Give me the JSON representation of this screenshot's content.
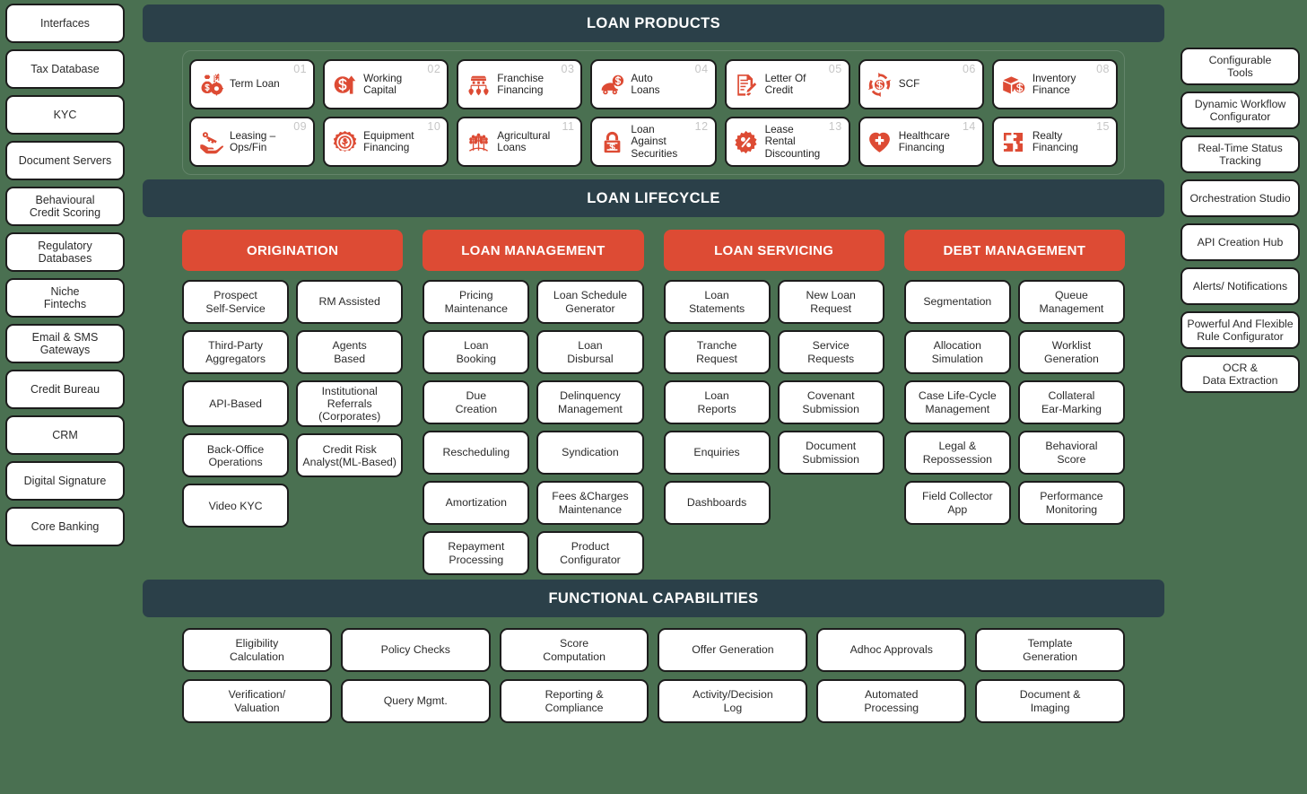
{
  "colors": {
    "background": "#4a7051",
    "band": "#2b4049",
    "accent": "#dd4b34",
    "card_bg": "#ffffff",
    "card_border": "#1c1c1c",
    "number": "#c6c6c6"
  },
  "left_sidebar": {
    "items": [
      {
        "label": "Interfaces"
      },
      {
        "label": "Tax Database"
      },
      {
        "label": "KYC"
      },
      {
        "label": "Document Servers"
      },
      {
        "label": "Behavioural\nCredit Scoring"
      },
      {
        "label": "Regulatory\nDatabases"
      },
      {
        "label": "Niche\nFintechs"
      },
      {
        "label": "Email & SMS\nGateways"
      },
      {
        "label": "Credit Bureau"
      },
      {
        "label": "CRM"
      },
      {
        "label": "Digital Signature"
      },
      {
        "label": "Core Banking"
      }
    ]
  },
  "right_sidebar": {
    "items": [
      {
        "label": "Configurable\nTools"
      },
      {
        "label": "Dynamic Workflow\nConfigurator"
      },
      {
        "label": "Real-Time Status\nTracking"
      },
      {
        "label": "Orchestration Studio"
      },
      {
        "label": "API Creation Hub"
      },
      {
        "label": "Alerts/ Notifications"
      },
      {
        "label": "Powerful And Flexible\nRule Configurator"
      },
      {
        "label": "OCR &\nData Extraction"
      }
    ]
  },
  "loan_products": {
    "band_title": "LOAN PRODUCTS",
    "items": [
      {
        "number": "01",
        "label": "Term Loan",
        "icon": "money-bag-exchange-icon"
      },
      {
        "number": "02",
        "label": "Working\nCapital",
        "icon": "dollar-arrow-up-icon"
      },
      {
        "number": "03",
        "label": "Franchise\nFinancing",
        "icon": "franchise-network-icon"
      },
      {
        "number": "04",
        "label": "Auto\nLoans",
        "icon": "car-dollar-icon"
      },
      {
        "number": "05",
        "label": "Letter Of\nCredit",
        "icon": "document-pen-icon"
      },
      {
        "number": "06",
        "label": "SCF",
        "icon": "dollar-cycle-icon"
      },
      {
        "number": "08",
        "label": "Inventory\nFinance",
        "icon": "box-dollar-icon"
      },
      {
        "number": "09",
        "label": "Leasing –\nOps/Fin",
        "icon": "key-hand-icon"
      },
      {
        "number": "10",
        "label": "Equipment\nFinancing",
        "icon": "gear-plant-icon"
      },
      {
        "number": "11",
        "label": "Agricultural\nLoans",
        "icon": "wheat-icon"
      },
      {
        "number": "12",
        "label": "Loan\nAgainst\nSecurities",
        "icon": "lock-dollar-icon"
      },
      {
        "number": "13",
        "label": "Lease\nRental\nDiscounting",
        "icon": "percent-badge-icon"
      },
      {
        "number": "14",
        "label": "Healthcare\nFinancing",
        "icon": "heart-cross-icon"
      },
      {
        "number": "15",
        "label": "Realty\nFinancing",
        "icon": "puzzle-building-icon"
      }
    ]
  },
  "loan_lifecycle": {
    "band_title": "LOAN LIFECYCLE",
    "columns": [
      {
        "title": "ORIGINATION",
        "items": [
          "Prospect\nSelf-Service",
          "RM Assisted",
          "Third-Party\nAggregators",
          "Agents\nBased",
          "API-Based",
          "Institutional\nReferrals\n(Corporates)",
          "Back-Office\nOperations",
          "Credit Risk\nAnalyst(ML-Based)",
          "Video KYC"
        ]
      },
      {
        "title": "LOAN MANAGEMENT",
        "items": [
          "Pricing\nMaintenance",
          "Loan Schedule\nGenerator",
          "Loan\nBooking",
          "Loan\nDisbursal",
          "Due\nCreation",
          "Delinquency\nManagement",
          "Rescheduling",
          "Syndication",
          "Amortization",
          "Fees &Charges\nMaintenance",
          "Repayment\nProcessing",
          "Product\nConfigurator"
        ]
      },
      {
        "title": "LOAN SERVICING",
        "items": [
          "Loan\nStatements",
          "New Loan\nRequest",
          "Tranche\nRequest",
          "Service\nRequests",
          "Loan\nReports",
          "Covenant\nSubmission",
          "Enquiries",
          "Document\nSubmission",
          "Dashboards"
        ]
      },
      {
        "title": "DEBT MANAGEMENT",
        "items": [
          "Segmentation",
          "Queue\nManagement",
          "Allocation\nSimulation",
          "Worklist\nGeneration",
          "Case Life-Cycle\nManagement",
          "Collateral\nEar-Marking",
          "Legal &\nRepossession",
          "Behavioral\nScore",
          "Field Collector\nApp",
          "Performance\nMonitoring"
        ]
      }
    ]
  },
  "functional_capabilities": {
    "band_title": "FUNCTIONAL CAPABILITIES",
    "items": [
      "Eligibility\nCalculation",
      "Policy Checks",
      "Score\nComputation",
      "Offer Generation",
      "Adhoc Approvals",
      "Template\nGeneration",
      "Verification/\nValuation",
      "Query Mgmt.",
      "Reporting &\nCompliance",
      "Activity/Decision\nLog",
      "Automated\nProcessing",
      "Document &\nImaging"
    ]
  }
}
